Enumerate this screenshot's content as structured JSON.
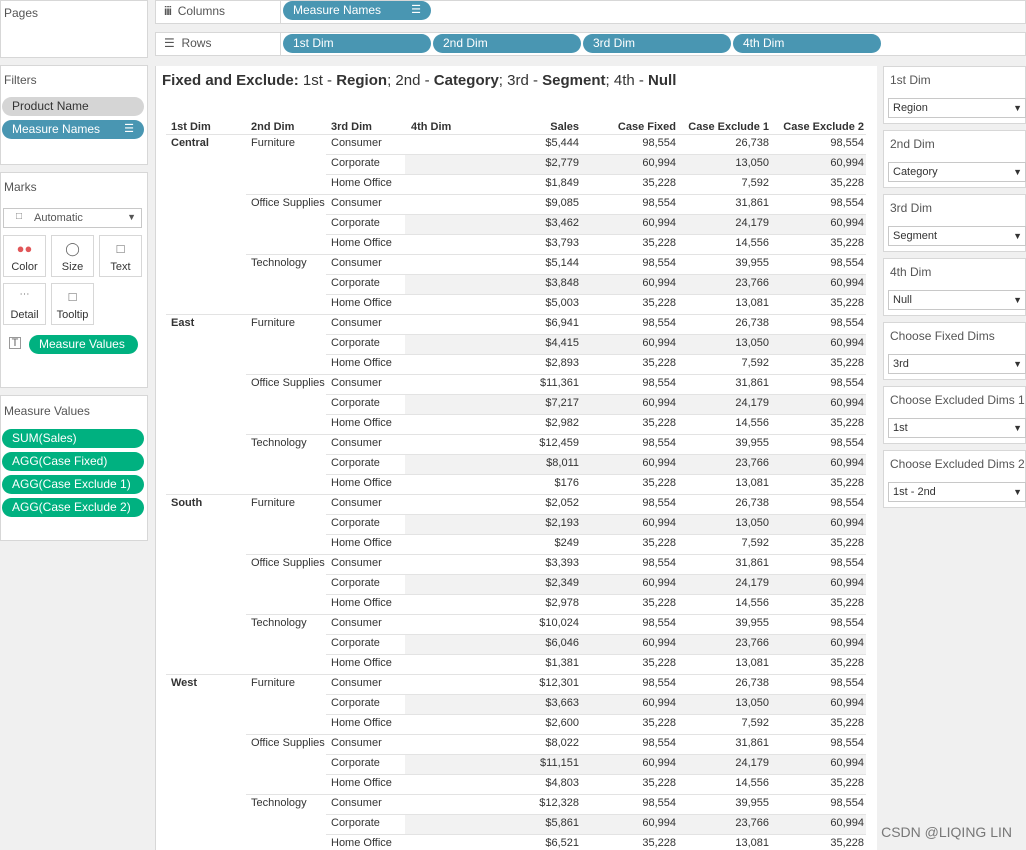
{
  "pages": {
    "title": "Pages"
  },
  "shelves": {
    "columns": {
      "icon": "columns-icon",
      "label": "Columns",
      "pills": [
        {
          "label": "Measure Names"
        }
      ]
    },
    "rows": {
      "icon": "rows-icon",
      "label": "Rows",
      "pills": [
        {
          "label": "1st Dim"
        },
        {
          "label": "2nd Dim"
        },
        {
          "label": "3rd Dim"
        },
        {
          "label": "4th Dim"
        }
      ]
    }
  },
  "filters": {
    "title": "Filters",
    "items": [
      {
        "label": "Product Name"
      },
      {
        "label": "Measure Names"
      }
    ]
  },
  "marks": {
    "title": "Marks",
    "type": "Automatic",
    "buttons": [
      {
        "label": "Color",
        "icon": "color-icon"
      },
      {
        "label": "Size",
        "icon": "size-icon"
      },
      {
        "label": "Text",
        "icon": "text-icon"
      },
      {
        "label": "Detail",
        "icon": "detail-icon"
      },
      {
        "label": "Tooltip",
        "icon": "tooltip-icon"
      }
    ],
    "text_pill": "Measure Values"
  },
  "measure_values": {
    "title": "Measure Values",
    "items": [
      "SUM(Sales)",
      "AGG(Case Fixed)",
      "AGG(Case Exclude 1)",
      "AGG(Case Exclude 2)"
    ]
  },
  "viz": {
    "title_parts": {
      "a": "Fixed and Exclude:",
      "b": " 1st - ",
      "c": "Region",
      "d": "; 2nd - ",
      "e": "Category",
      "f": "; 3rd - ",
      "g": "Segment",
      "h": "; 4th - ",
      "i": "Null"
    },
    "headers": {
      "dim1": "1st Dim",
      "dim2": "2nd Dim",
      "dim3": "3rd Dim",
      "dim4": "4th Dim",
      "sales": "Sales",
      "case_fixed": "Case Fixed",
      "case_exclude1": "Case Exclude 1",
      "case_exclude2": "Case Exclude 2"
    },
    "regions": [
      {
        "name": "Central",
        "categories": [
          {
            "name": "Furniture",
            "rows": [
              [
                "Consumer",
                "$5,444",
                "98,554",
                "26,738",
                "98,554"
              ],
              [
                "Corporate",
                "$2,779",
                "60,994",
                "13,050",
                "60,994"
              ],
              [
                "Home Office",
                "$1,849",
                "35,228",
                "7,592",
                "35,228"
              ]
            ]
          },
          {
            "name": "Office Supplies",
            "rows": [
              [
                "Consumer",
                "$9,085",
                "98,554",
                "31,861",
                "98,554"
              ],
              [
                "Corporate",
                "$3,462",
                "60,994",
                "24,179",
                "60,994"
              ],
              [
                "Home Office",
                "$3,793",
                "35,228",
                "14,556",
                "35,228"
              ]
            ]
          },
          {
            "name": "Technology",
            "rows": [
              [
                "Consumer",
                "$5,144",
                "98,554",
                "39,955",
                "98,554"
              ],
              [
                "Corporate",
                "$3,848",
                "60,994",
                "23,766",
                "60,994"
              ],
              [
                "Home Office",
                "$5,003",
                "35,228",
                "13,081",
                "35,228"
              ]
            ]
          }
        ]
      },
      {
        "name": "East",
        "categories": [
          {
            "name": "Furniture",
            "rows": [
              [
                "Consumer",
                "$6,941",
                "98,554",
                "26,738",
                "98,554"
              ],
              [
                "Corporate",
                "$4,415",
                "60,994",
                "13,050",
                "60,994"
              ],
              [
                "Home Office",
                "$2,893",
                "35,228",
                "7,592",
                "35,228"
              ]
            ]
          },
          {
            "name": "Office Supplies",
            "rows": [
              [
                "Consumer",
                "$11,361",
                "98,554",
                "31,861",
                "98,554"
              ],
              [
                "Corporate",
                "$7,217",
                "60,994",
                "24,179",
                "60,994"
              ],
              [
                "Home Office",
                "$2,982",
                "35,228",
                "14,556",
                "35,228"
              ]
            ]
          },
          {
            "name": "Technology",
            "rows": [
              [
                "Consumer",
                "$12,459",
                "98,554",
                "39,955",
                "98,554"
              ],
              [
                "Corporate",
                "$8,011",
                "60,994",
                "23,766",
                "60,994"
              ],
              [
                "Home Office",
                "$176",
                "35,228",
                "13,081",
                "35,228"
              ]
            ]
          }
        ]
      },
      {
        "name": "South",
        "categories": [
          {
            "name": "Furniture",
            "rows": [
              [
                "Consumer",
                "$2,052",
                "98,554",
                "26,738",
                "98,554"
              ],
              [
                "Corporate",
                "$2,193",
                "60,994",
                "13,050",
                "60,994"
              ],
              [
                "Home Office",
                "$249",
                "35,228",
                "7,592",
                "35,228"
              ]
            ]
          },
          {
            "name": "Office Supplies",
            "rows": [
              [
                "Consumer",
                "$3,393",
                "98,554",
                "31,861",
                "98,554"
              ],
              [
                "Corporate",
                "$2,349",
                "60,994",
                "24,179",
                "60,994"
              ],
              [
                "Home Office",
                "$2,978",
                "35,228",
                "14,556",
                "35,228"
              ]
            ]
          },
          {
            "name": "Technology",
            "rows": [
              [
                "Consumer",
                "$10,024",
                "98,554",
                "39,955",
                "98,554"
              ],
              [
                "Corporate",
                "$6,046",
                "60,994",
                "23,766",
                "60,994"
              ],
              [
                "Home Office",
                "$1,381",
                "35,228",
                "13,081",
                "35,228"
              ]
            ]
          }
        ]
      },
      {
        "name": "West",
        "categories": [
          {
            "name": "Furniture",
            "rows": [
              [
                "Consumer",
                "$12,301",
                "98,554",
                "26,738",
                "98,554"
              ],
              [
                "Corporate",
                "$3,663",
                "60,994",
                "13,050",
                "60,994"
              ],
              [
                "Home Office",
                "$2,600",
                "35,228",
                "7,592",
                "35,228"
              ]
            ]
          },
          {
            "name": "Office Supplies",
            "rows": [
              [
                "Consumer",
                "$8,022",
                "98,554",
                "31,861",
                "98,554"
              ],
              [
                "Corporate",
                "$11,151",
                "60,994",
                "24,179",
                "60,994"
              ],
              [
                "Home Office",
                "$4,803",
                "35,228",
                "14,556",
                "35,228"
              ]
            ]
          },
          {
            "name": "Technology",
            "rows": [
              [
                "Consumer",
                "$12,328",
                "98,554",
                "39,955",
                "98,554"
              ],
              [
                "Corporate",
                "$5,861",
                "60,994",
                "23,766",
                "60,994"
              ],
              [
                "Home Office",
                "$6,521",
                "35,228",
                "13,081",
                "35,228"
              ]
            ]
          }
        ]
      }
    ]
  },
  "parameters": [
    {
      "label": "1st Dim",
      "value": "Region"
    },
    {
      "label": "2nd Dim",
      "value": "Category"
    },
    {
      "label": "3rd Dim",
      "value": "Segment"
    },
    {
      "label": "4th Dim",
      "value": "Null"
    },
    {
      "label": "Choose Fixed Dims",
      "value": "3rd"
    },
    {
      "label": "Choose Excluded Dims 1",
      "value": "1st"
    },
    {
      "label": "Choose Excluded Dims 2",
      "value": "1st - 2nd"
    }
  ],
  "watermark": "CSDN @LIQING LIN"
}
